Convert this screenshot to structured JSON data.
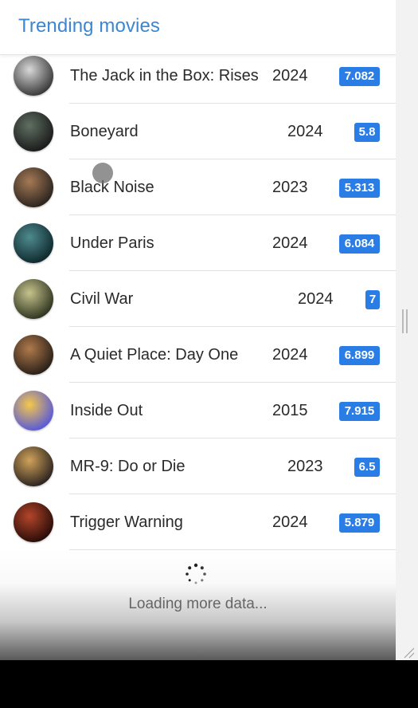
{
  "header": {
    "title": "Trending movies"
  },
  "movies": [
    {
      "title": "The Jack in the Box: Rises",
      "year": "2024",
      "rating": "7.082",
      "poster_icon": "jack-in-the-box-poster",
      "colors": [
        "#d8d8d8",
        "#3a3a3a"
      ]
    },
    {
      "title": "Boneyard",
      "year": "2024",
      "rating": "5.8",
      "poster_icon": "boneyard-poster",
      "colors": [
        "#5f6f62",
        "#1b1b1b"
      ]
    },
    {
      "title": "Black Noise",
      "year": "2023",
      "rating": "5.313",
      "poster_icon": "black-noise-poster",
      "colors": [
        "#a57a56",
        "#2c241e"
      ]
    },
    {
      "title": "Under Paris",
      "year": "2024",
      "rating": "6.084",
      "poster_icon": "under-paris-poster",
      "colors": [
        "#4f8b8f",
        "#0f2a2e"
      ]
    },
    {
      "title": "Civil War",
      "year": "2024",
      "rating": "7",
      "poster_icon": "civil-war-poster",
      "colors": [
        "#c7c38d",
        "#2f3621"
      ]
    },
    {
      "title": "A Quiet Place: Day One",
      "year": "2024",
      "rating": "6.899",
      "poster_icon": "quiet-place-poster",
      "colors": [
        "#b07a4b",
        "#2a2018"
      ]
    },
    {
      "title": "Inside Out",
      "year": "2015",
      "rating": "7.915",
      "poster_icon": "inside-out-poster",
      "colors": [
        "#f4c84a",
        "#5a5ad8"
      ]
    },
    {
      "title": "MR-9: Do or Die",
      "year": "2023",
      "rating": "6.5",
      "poster_icon": "mr9-poster",
      "colors": [
        "#d1a25a",
        "#2d2520"
      ]
    },
    {
      "title": "Trigger Warning",
      "year": "2024",
      "rating": "5.879",
      "poster_icon": "trigger-warning-poster",
      "colors": [
        "#b3452a",
        "#2a0d08"
      ]
    }
  ],
  "loading": {
    "text": "Loading more data..."
  },
  "theme": {
    "accent": "#3c86d2",
    "badge": "#2b7de6"
  }
}
